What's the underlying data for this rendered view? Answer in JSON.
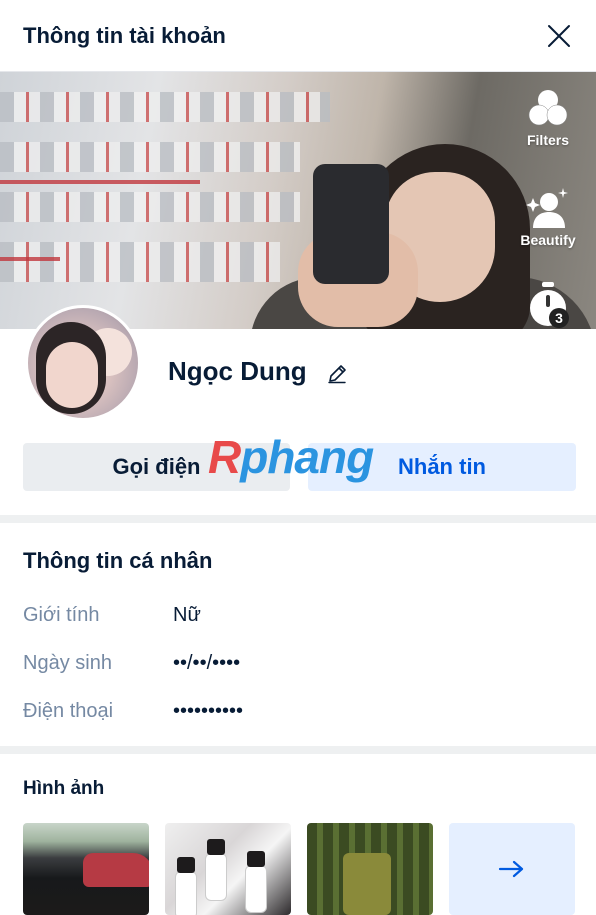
{
  "header": {
    "title": "Thông tin tài khoản"
  },
  "camera_tools": {
    "filters_label": "Filters",
    "beautify_label": "Beautify",
    "timer_value": "3"
  },
  "profile": {
    "name": "Ngọc Dung"
  },
  "actions": {
    "call_label": "Gọi điện",
    "message_label": "Nhắn tin"
  },
  "watermark": {
    "part1": "R",
    "part2": "phang"
  },
  "personal_info": {
    "title": "Thông tin cá nhân",
    "rows": [
      {
        "label": "Giới tính",
        "value": "Nữ"
      },
      {
        "label": "Ngày sinh",
        "value": "••/••/••••"
      },
      {
        "label": "Điện thoại",
        "value": "••••••••••"
      }
    ]
  },
  "photos": {
    "title": "Hình ảnh"
  },
  "colors": {
    "accent": "#005ae0",
    "accent_bg": "#e5efff",
    "text_primary": "#081c36",
    "text_secondary": "#7589a3",
    "divider": "#eef0f1"
  }
}
